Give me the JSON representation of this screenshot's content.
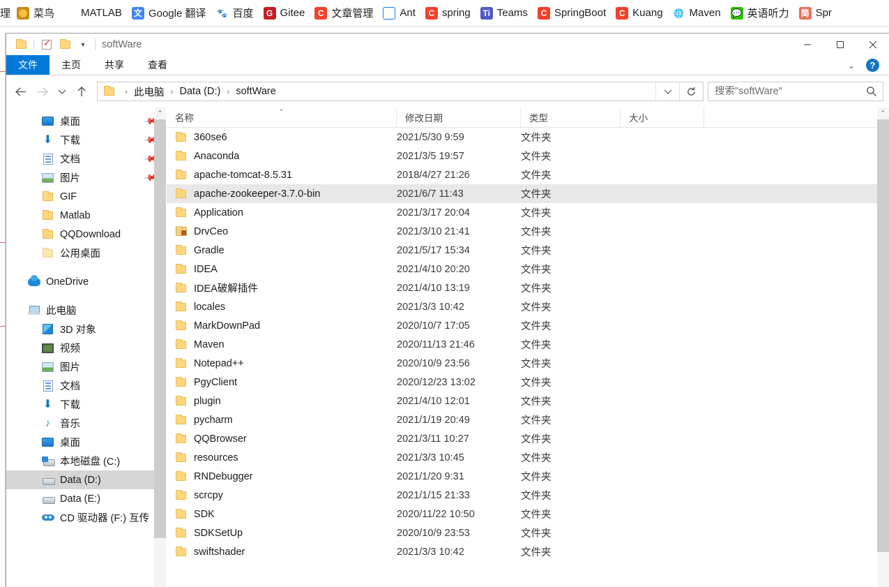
{
  "browser": {
    "bookmarks": [
      {
        "label": "菜鸟",
        "icon": "cainiao-icon"
      },
      {
        "label": "MATLAB",
        "icon": "matlab-icon"
      },
      {
        "label": "Google 翻译",
        "icon": "google-translate-icon"
      },
      {
        "label": "百度",
        "icon": "baidu-icon"
      },
      {
        "label": "Gitee",
        "icon": "gitee-icon"
      },
      {
        "label": "文章管理",
        "icon": "csdn-icon"
      },
      {
        "label": "Ant",
        "icon": "ant-design-icon"
      },
      {
        "label": "spring",
        "icon": "csdn-icon"
      },
      {
        "label": "Teams",
        "icon": "teams-icon"
      },
      {
        "label": "SpringBoot",
        "icon": "csdn-icon"
      },
      {
        "label": "Kuang",
        "icon": "csdn-icon"
      },
      {
        "label": "Maven",
        "icon": "globe-icon"
      },
      {
        "label": "英语听力",
        "icon": "wechat-icon"
      },
      {
        "label": "Spr",
        "icon": "jianshu-icon"
      }
    ],
    "leading_partial": "理"
  },
  "window": {
    "title": "softWare",
    "quick_access": [
      "folder-icon",
      "properties-checkbox-icon",
      "new-folder-icon",
      "customize-caret-icon"
    ],
    "controls": {
      "minimize": "minimize-icon",
      "maximize": "maximize-icon",
      "close": "close-icon"
    },
    "ribbon_collapse": "chevron-down-icon",
    "help": "?"
  },
  "ribbon": {
    "tabs": [
      {
        "label": "文件",
        "active": true
      },
      {
        "label": "主页",
        "active": false
      },
      {
        "label": "共享",
        "active": false
      },
      {
        "label": "查看",
        "active": false
      }
    ]
  },
  "navbar": {
    "back": "back-arrow-icon",
    "forward": "forward-arrow-icon",
    "recent": "recent-locations-icon",
    "up": "up-arrow-icon",
    "breadcrumb": [
      "此电脑",
      "Data (D:)",
      "softWare"
    ],
    "address_dropdown": "chevron-down-icon",
    "refresh": "refresh-icon"
  },
  "search": {
    "placeholder": "搜索\"softWare\"",
    "value": "",
    "icon": "search-icon"
  },
  "nav_pane": {
    "quick_access": [
      {
        "label": "桌面",
        "icon": "desktop-icon",
        "pinned": true
      },
      {
        "label": "下载",
        "icon": "download-icon",
        "pinned": true
      },
      {
        "label": "文档",
        "icon": "documents-icon",
        "pinned": true
      },
      {
        "label": "图片",
        "icon": "pictures-icon",
        "pinned": true
      },
      {
        "label": "GIF",
        "icon": "folder-icon",
        "pinned": false
      },
      {
        "label": "Matlab",
        "icon": "folder-icon",
        "pinned": false
      },
      {
        "label": "QQDownload",
        "icon": "folder-icon",
        "pinned": false
      },
      {
        "label": "公用桌面",
        "icon": "folder-icon",
        "pinned": false
      }
    ],
    "onedrive": {
      "label": "OneDrive",
      "icon": "onedrive-icon"
    },
    "this_pc": {
      "label": "此电脑",
      "icon": "this-pc-icon"
    },
    "this_pc_children": [
      {
        "label": "3D 对象",
        "icon": "3d-objects-icon"
      },
      {
        "label": "视频",
        "icon": "videos-icon"
      },
      {
        "label": "图片",
        "icon": "pictures-icon"
      },
      {
        "label": "文档",
        "icon": "documents-icon"
      },
      {
        "label": "下载",
        "icon": "download-icon"
      },
      {
        "label": "音乐",
        "icon": "music-icon"
      },
      {
        "label": "桌面",
        "icon": "desktop-icon"
      },
      {
        "label": "本地磁盘 (C:)",
        "icon": "windows-drive-icon"
      },
      {
        "label": "Data (D:)",
        "icon": "drive-icon",
        "selected": true
      },
      {
        "label": "Data (E:)",
        "icon": "drive-icon"
      },
      {
        "label": "CD 驱动器 (F:) 互传",
        "icon": "cd-drive-icon"
      }
    ]
  },
  "file_list": {
    "columns": [
      "名称",
      "修改日期",
      "类型",
      "大小"
    ],
    "sort_column": "名称",
    "sort_direction": "asc",
    "rows": [
      {
        "name": "360se6",
        "date": "2021/5/30 9:59",
        "type": "文件夹",
        "size": "",
        "icon": "folder-icon",
        "selected": false
      },
      {
        "name": "Anaconda",
        "date": "2021/3/5 19:57",
        "type": "文件夹",
        "size": "",
        "icon": "folder-icon",
        "selected": false
      },
      {
        "name": "apache-tomcat-8.5.31",
        "date": "2018/4/27 21:26",
        "type": "文件夹",
        "size": "",
        "icon": "folder-icon",
        "selected": false
      },
      {
        "name": "apache-zookeeper-3.7.0-bin",
        "date": "2021/6/7 11:43",
        "type": "文件夹",
        "size": "",
        "icon": "folder-icon",
        "selected": true
      },
      {
        "name": "Application",
        "date": "2021/3/17 20:04",
        "type": "文件夹",
        "size": "",
        "icon": "folder-icon",
        "selected": false
      },
      {
        "name": "DrvCeo",
        "date": "2021/3/10 21:41",
        "type": "文件夹",
        "size": "",
        "icon": "special-folder-icon",
        "selected": false
      },
      {
        "name": "Gradle",
        "date": "2021/5/17 15:34",
        "type": "文件夹",
        "size": "",
        "icon": "folder-icon",
        "selected": false
      },
      {
        "name": "IDEA",
        "date": "2021/4/10 20:20",
        "type": "文件夹",
        "size": "",
        "icon": "folder-icon",
        "selected": false
      },
      {
        "name": "IDEA破解插件",
        "date": "2021/4/10 13:19",
        "type": "文件夹",
        "size": "",
        "icon": "folder-icon",
        "selected": false
      },
      {
        "name": "locales",
        "date": "2021/3/3 10:42",
        "type": "文件夹",
        "size": "",
        "icon": "folder-icon",
        "selected": false
      },
      {
        "name": "MarkDownPad",
        "date": "2020/10/7 17:05",
        "type": "文件夹",
        "size": "",
        "icon": "folder-icon",
        "selected": false
      },
      {
        "name": "Maven",
        "date": "2020/11/13 21:46",
        "type": "文件夹",
        "size": "",
        "icon": "folder-icon",
        "selected": false
      },
      {
        "name": "Notepad++",
        "date": "2020/10/9 23:56",
        "type": "文件夹",
        "size": "",
        "icon": "folder-icon",
        "selected": false
      },
      {
        "name": "PgyClient",
        "date": "2020/12/23 13:02",
        "type": "文件夹",
        "size": "",
        "icon": "folder-icon",
        "selected": false
      },
      {
        "name": "plugin",
        "date": "2021/4/10 12:01",
        "type": "文件夹",
        "size": "",
        "icon": "folder-icon",
        "selected": false
      },
      {
        "name": "pycharm",
        "date": "2021/1/19 20:49",
        "type": "文件夹",
        "size": "",
        "icon": "folder-icon",
        "selected": false
      },
      {
        "name": "QQBrowser",
        "date": "2021/3/11 10:27",
        "type": "文件夹",
        "size": "",
        "icon": "folder-icon",
        "selected": false
      },
      {
        "name": "resources",
        "date": "2021/3/3 10:45",
        "type": "文件夹",
        "size": "",
        "icon": "folder-icon",
        "selected": false
      },
      {
        "name": "RNDebugger",
        "date": "2021/1/20 9:31",
        "type": "文件夹",
        "size": "",
        "icon": "folder-icon",
        "selected": false
      },
      {
        "name": "scrcpy",
        "date": "2021/1/15 21:33",
        "type": "文件夹",
        "size": "",
        "icon": "folder-icon",
        "selected": false
      },
      {
        "name": "SDK",
        "date": "2020/11/22 10:50",
        "type": "文件夹",
        "size": "",
        "icon": "folder-icon",
        "selected": false
      },
      {
        "name": "SDKSetUp",
        "date": "2020/10/9 23:53",
        "type": "文件夹",
        "size": "",
        "icon": "folder-icon",
        "selected": false
      },
      {
        "name": "swiftshader",
        "date": "2021/3/3 10:42",
        "type": "文件夹",
        "size": "",
        "icon": "folder-icon",
        "selected": false
      }
    ]
  },
  "colors": {
    "accent": "#0078d7",
    "selection": "#e8e8e8",
    "nav_selection": "#d6d6d6",
    "folder": "#fcd77f"
  }
}
